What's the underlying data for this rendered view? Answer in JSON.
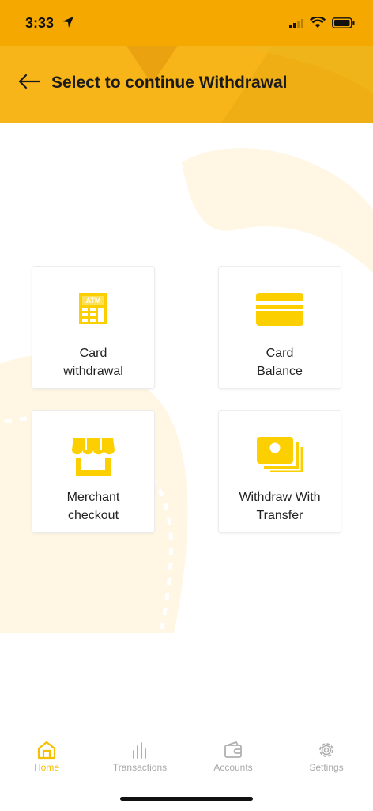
{
  "status_bar": {
    "time": "3:33"
  },
  "header": {
    "title": "Select to continue Withdrawal"
  },
  "options": [
    {
      "line1": "Card",
      "line2": "withdrawal",
      "icon": "atm-icon"
    },
    {
      "line1": "Card",
      "line2": "Balance",
      "icon": "credit-card-icon"
    },
    {
      "line1": "Merchant",
      "line2": "checkout",
      "icon": "storefront-icon"
    },
    {
      "line1": "Withdraw With",
      "line2": "Transfer",
      "icon": "cash-icon"
    }
  ],
  "atm_icon_text": "ATM",
  "nav": [
    {
      "label": "Home",
      "icon": "home-icon",
      "active": true
    },
    {
      "label": "Transactions",
      "icon": "bar-chart-icon",
      "active": false
    },
    {
      "label": "Accounts",
      "icon": "wallet-icon",
      "active": false
    },
    {
      "label": "Settings",
      "icon": "gear-icon",
      "active": false
    }
  ],
  "colors": {
    "primary": "#f5b700",
    "header": "#f7b51a",
    "icon": "#fcd000",
    "nav_active": "#f5c000",
    "nav_inactive": "#a9a9a9"
  }
}
